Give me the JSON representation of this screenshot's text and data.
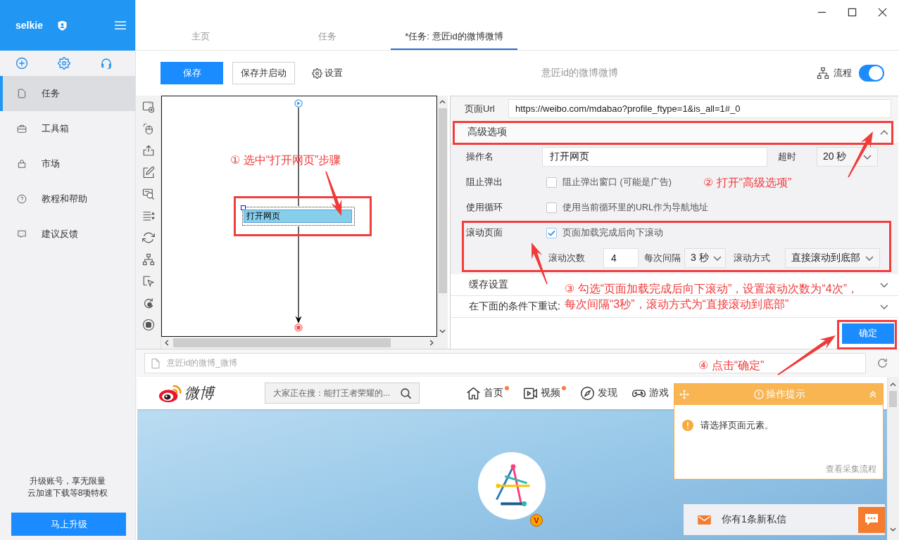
{
  "sidebar": {
    "brand": "selkie",
    "items": [
      {
        "label": "任务",
        "selected": true
      },
      {
        "label": "工具箱",
        "selected": false
      },
      {
        "label": "市场",
        "selected": false
      },
      {
        "label": "教程和帮助",
        "selected": false
      },
      {
        "label": "建议反馈",
        "selected": false
      }
    ],
    "promo": {
      "lines": [
        "升级账号，享无限量",
        "云加速下载等8项特权"
      ],
      "button": "马上升级"
    }
  },
  "tabs": [
    {
      "label": "主页",
      "selected": false
    },
    {
      "label": "任务",
      "selected": false
    },
    {
      "label": "*任务: 意匠id的微博微博",
      "selected": true
    }
  ],
  "toolbar": {
    "buttons": [
      {
        "label": "保存",
        "kind": "primary"
      },
      {
        "label": "保存并启动",
        "kind": "default"
      },
      {
        "label": "设置",
        "kind": "settings"
      }
    ],
    "title": "意匠id的微博微博",
    "flow": {
      "label": "流程",
      "on": true
    }
  },
  "flow_chart": {
    "steps": [
      {
        "label": "打开网页",
        "selected": true
      }
    ]
  },
  "properties": {
    "url": {
      "label": "页面Url",
      "value": "https://weibo.com/mdabao?profile_ftype=1&is_all=1#_0"
    },
    "advanced": {
      "title": "高级选项",
      "expanded": true,
      "action_name": {
        "label": "操作名",
        "value": "打开网页"
      },
      "timeout": {
        "label": "超时",
        "value": "20 秒"
      },
      "options": [
        {
          "label": "阻止弹出",
          "text": "阻止弹出窗口 (可能是广告)",
          "checked": false
        },
        {
          "label": "使用循环",
          "text": "使用当前循环里的URL作为导航地址",
          "checked": false
        },
        {
          "label": "滚动页面",
          "text": "页面加载完成后向下滚动",
          "checked": true
        }
      ],
      "scroll_settings": [
        {
          "label": "滚动次数",
          "value": "4",
          "kind": "input"
        },
        {
          "label": "每次间隔",
          "value": "3 秒",
          "kind": "select"
        },
        {
          "label": "滚动方式",
          "value": "直接滚动到底部",
          "kind": "select"
        }
      ]
    },
    "sections": [
      {
        "title": "缓存设置",
        "expanded": false
      },
      {
        "title": "在下面的条件下重试:",
        "expanded": false
      }
    ],
    "confirm": "确定"
  },
  "browser": {
    "address": "意匠id的微博_微博",
    "page": {
      "logo": "微博",
      "search_placeholder": "大家正在搜：能打王者荣耀的...",
      "nav": [
        {
          "label": "首页",
          "new": true
        },
        {
          "label": "视频",
          "new": true
        },
        {
          "label": "发现",
          "new": false
        },
        {
          "label": "游戏",
          "new": false
        }
      ],
      "verified_badge": "V",
      "message": "你有1条新私信"
    },
    "tip": {
      "title": "操作提示",
      "message": "请选择页面元素。",
      "link": "查看采集流程"
    }
  },
  "annotations": [
    {
      "lines": [
        "① 选中“打开网页”步骤"
      ]
    },
    {
      "lines": [
        "② 打开“高级选项”"
      ]
    },
    {
      "lines": [
        "③ 勾选“页面加载完成后向下滚动”，设置滚动次数为“4次”，",
        "每次间隔“3秒”，滚动方式为“直接滚动到底部”"
      ]
    },
    {
      "lines": [
        "④ 点击“确定”"
      ]
    }
  ]
}
